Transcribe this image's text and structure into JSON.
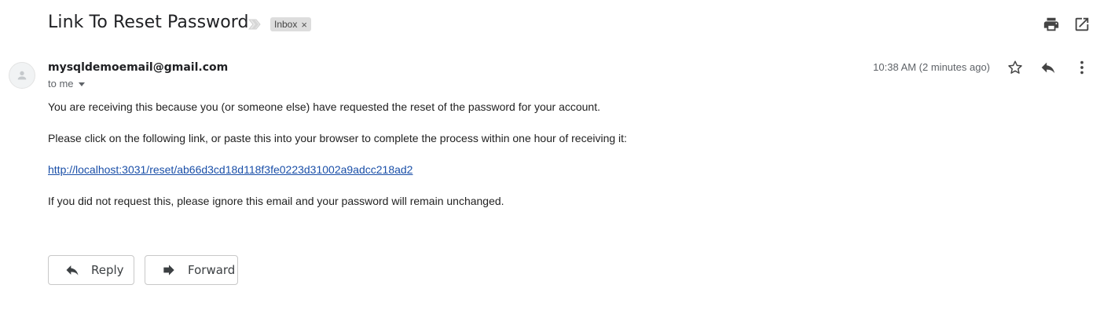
{
  "email": {
    "subject": "Link To Reset Password",
    "label": "Inbox",
    "label_remove": "×",
    "sender": "mysqldemoemail@gmail.com",
    "recipient": "to me",
    "timestamp": "10:38 AM (2 minutes ago)",
    "body": {
      "line1": "You are receiving this because you (or someone else) have requested the reset of the password for your account.",
      "line2": "Please click on the following link, or paste this into your browser to complete the process within one hour of receiving it:",
      "link": "http://localhost:3031/reset/ab66d3cd18d118f3fe0223d31002a9adcc218ad2",
      "line3": "If you did not request this, please ignore this email and your password will remain unchanged."
    }
  },
  "actions": {
    "reply_label": "Reply",
    "forward_label": "Forward"
  },
  "icons": {
    "print": "print-icon",
    "open_new_window": "open-in-new-window-icon",
    "star": "star-icon",
    "reply": "reply-icon",
    "more": "more-vertical-icon",
    "importance": "importance-marker-icon",
    "avatar": "default-avatar-icon",
    "forward": "forward-icon"
  },
  "colors": {
    "link": "#1a4fa8",
    "label_chip_bg": "#dddddd",
    "secondary_text": "#5f6368"
  }
}
